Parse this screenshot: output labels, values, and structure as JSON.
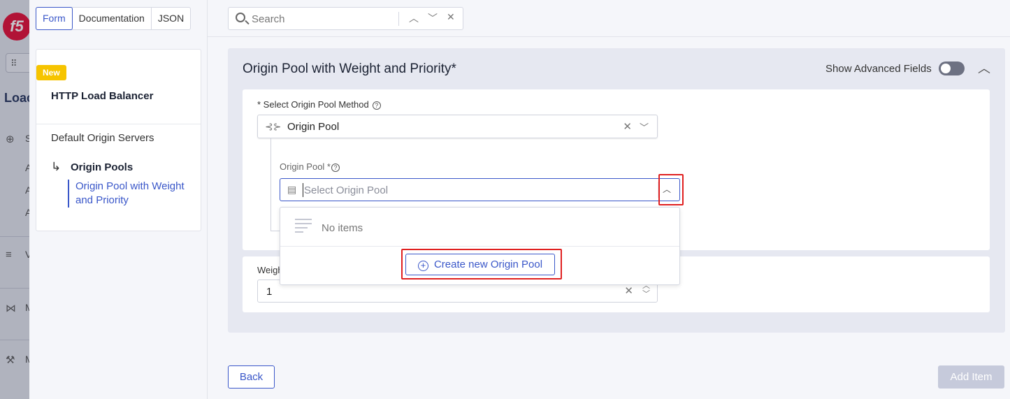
{
  "background": {
    "logo_text": "f5",
    "grid_icon": "grid-icon",
    "title_fragment": "Loac",
    "rows": [
      {
        "icon": "globe-icon",
        "glyph": "⊕",
        "text": "S"
      },
      {
        "icon": "none",
        "glyph": "",
        "text": "A"
      },
      {
        "icon": "none",
        "glyph": "",
        "text": "A"
      },
      {
        "icon": "none",
        "glyph": "",
        "text": "A"
      },
      {
        "icon": "layers-icon",
        "glyph": "≡",
        "text": "V"
      },
      {
        "icon": "network-icon",
        "glyph": "⋈",
        "text": "M"
      },
      {
        "icon": "wrench-icon",
        "glyph": "⚒",
        "text": "M"
      }
    ]
  },
  "tabs": [
    {
      "label": "Form",
      "active": true
    },
    {
      "label": "Documentation",
      "active": false
    },
    {
      "label": "JSON",
      "active": false
    }
  ],
  "nav": {
    "badge": "New",
    "title": "HTTP Load Balancer",
    "item": "Default Origin Servers",
    "sub_item": "Origin Pools",
    "leaf_item": "Origin Pool with Weight and Priority"
  },
  "search": {
    "placeholder": "Search",
    "value": ""
  },
  "section": {
    "title": "Origin Pool with Weight and Priority",
    "required_mark": "*",
    "advanced_label": "Show Advanced Fields",
    "advanced_enabled": false
  },
  "method_field": {
    "label": "* Select Origin Pool Method",
    "value": "Origin Pool",
    "icon": "origin-pool-icon"
  },
  "pool_field": {
    "label": "Origin Pool *",
    "placeholder": "Select Origin Pool",
    "value": "",
    "icon": "pool-list-icon"
  },
  "dropdown": {
    "empty_text": "No items",
    "create_label": "Create new Origin Pool"
  },
  "weight_field": {
    "label": "Weigh",
    "value": "1"
  },
  "footer": {
    "back_label": "Back",
    "add_label": "Add Item"
  },
  "colors": {
    "accent": "#3a57c9",
    "highlight": "#e02020",
    "badge": "#f6c400",
    "brand": "#e4002b"
  }
}
